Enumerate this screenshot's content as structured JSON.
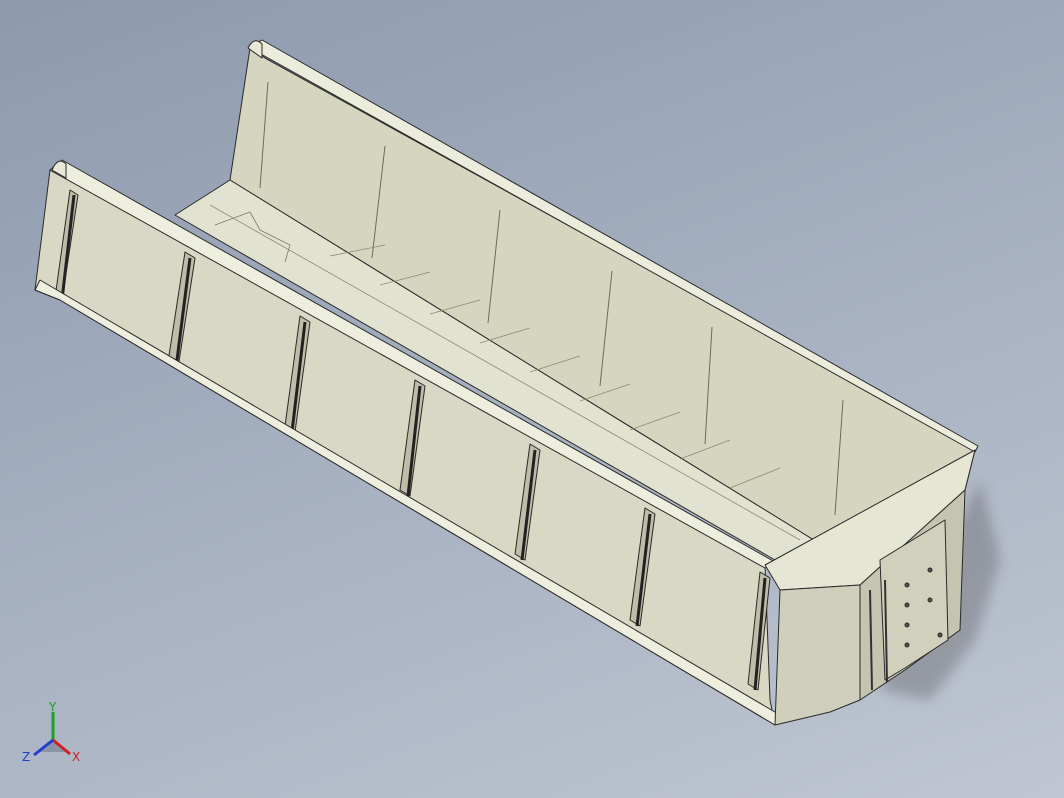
{
  "viewport": {
    "background_top": "#8d9aad",
    "background_bottom": "#c0c6d2"
  },
  "model": {
    "name_icon": "dump-truck-body-model",
    "face_color": "#dcdcc8",
    "edge_color": "#2a2a2a"
  },
  "triad": {
    "x_label": "X",
    "y_label": "Y",
    "z_label": "Z",
    "x_color": "#d02020",
    "y_color": "#20a020",
    "z_color": "#2040d0"
  }
}
